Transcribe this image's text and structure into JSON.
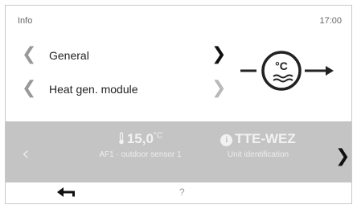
{
  "header": {
    "title": "Info",
    "time": "17:00"
  },
  "menu": [
    {
      "label": "General"
    },
    {
      "label": "Heat gen. module"
    }
  ],
  "device_icon": {
    "symbol": "°C",
    "name": "outdoor-temperature-device-icon"
  },
  "readout": {
    "value1": "15,0",
    "unit1": "°C",
    "label1": "AF1 · outdoor sensor 1",
    "value2": "TTE-WEZ",
    "label2": "Unit identification"
  },
  "footer": {
    "help": "?"
  },
  "colors": {
    "band": "#c4c4c4",
    "text": "#222222",
    "muted": "#999999"
  }
}
